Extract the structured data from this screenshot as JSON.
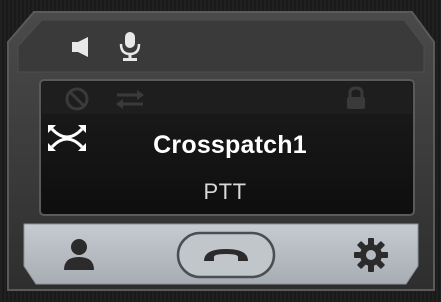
{
  "tile": {
    "name": "Crosspatch1",
    "mode": "PTT"
  },
  "icons": {
    "speaker": "speaker-icon",
    "microphone": "microphone-icon",
    "blocked": "blocked-icon",
    "transfer": "transfer-arrows-icon",
    "lock": "lock-icon",
    "crosspatch": "crosspatch-icon",
    "user": "user-icon",
    "handset": "handset-icon",
    "settings": "gear-icon"
  },
  "colors": {
    "frame": "#3c3c3c",
    "display": "#141414",
    "bottom_bar": "#b4bac0",
    "text_primary": "#ffffff",
    "text_secondary": "#d9d9d9"
  }
}
